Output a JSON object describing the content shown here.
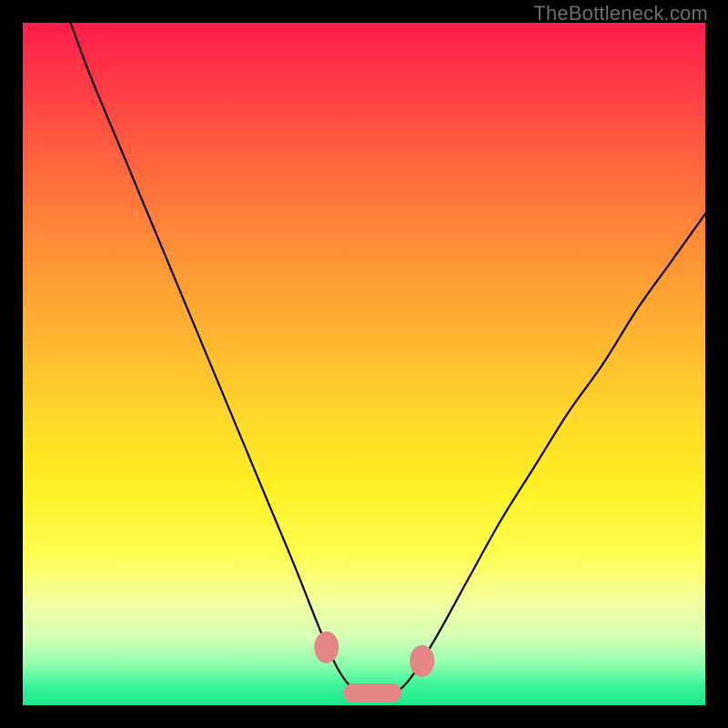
{
  "watermark": "TheBottleneck.com",
  "chart_data": {
    "type": "line",
    "title": "",
    "xlabel": "",
    "ylabel": "",
    "xlim": [
      0,
      1
    ],
    "ylim": [
      0,
      1
    ],
    "series": [
      {
        "name": "bottleneck-curve",
        "x": [
          0.07,
          0.1,
          0.15,
          0.2,
          0.25,
          0.3,
          0.35,
          0.4,
          0.44,
          0.47,
          0.5,
          0.53,
          0.56,
          0.6,
          0.65,
          0.7,
          0.75,
          0.8,
          0.85,
          0.9,
          0.95,
          1.0
        ],
        "y": [
          1.0,
          0.92,
          0.8,
          0.68,
          0.56,
          0.44,
          0.32,
          0.2,
          0.1,
          0.04,
          0.015,
          0.015,
          0.03,
          0.09,
          0.18,
          0.27,
          0.35,
          0.43,
          0.5,
          0.58,
          0.65,
          0.72
        ],
        "color": "#000000",
        "stroke_width": 2.2
      }
    ],
    "markers": [
      {
        "name": "left-dot",
        "x": 0.445,
        "y": 0.085,
        "r": 0.018,
        "color": "#e68585"
      },
      {
        "name": "valley-blob",
        "type": "pill",
        "x0": 0.47,
        "x1": 0.555,
        "y": 0.018,
        "thickness": 0.028,
        "color": "#e68585"
      },
      {
        "name": "right-dot",
        "x": 0.585,
        "y": 0.065,
        "r": 0.018,
        "color": "#e68585"
      }
    ],
    "background": {
      "gradient": [
        "#ff1c4a",
        "#ff6a3d",
        "#ffd62a",
        "#feff52",
        "#8effb0",
        "#17e889"
      ]
    }
  }
}
